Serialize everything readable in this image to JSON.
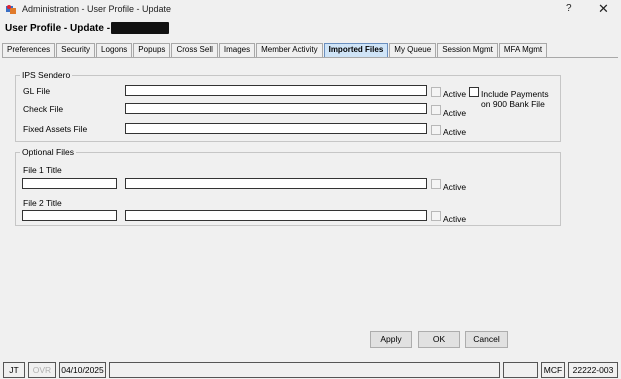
{
  "window": {
    "title": "Administration - User Profile - Update",
    "help": "?",
    "close": "✕"
  },
  "header": {
    "title": "User Profile - Update -"
  },
  "tabs": [
    {
      "label": "Preferences"
    },
    {
      "label": "Security"
    },
    {
      "label": "Logons"
    },
    {
      "label": "Popups"
    },
    {
      "label": "Cross Sell"
    },
    {
      "label": "Images"
    },
    {
      "label": "Member Activity"
    },
    {
      "label": "Imported Files",
      "active": true
    },
    {
      "label": "My Queue"
    },
    {
      "label": "Session Mgmt"
    },
    {
      "label": "MFA Mgmt"
    }
  ],
  "ips_sendero": {
    "legend": "IPS Sendero",
    "gl_file": {
      "label": "GL File",
      "value": "",
      "active_label": "Active"
    },
    "check_file": {
      "label": "Check File",
      "value": "",
      "active_label": "Active"
    },
    "fixed_assets_file": {
      "label": "Fixed Assets File",
      "value": "",
      "active_label": "Active"
    },
    "include_payments": {
      "label_line1": "Include Payments",
      "label_line2": "on 900 Bank File"
    }
  },
  "optional_files": {
    "legend": "Optional Files",
    "file1": {
      "label": "File 1 Title",
      "title_value": "",
      "path_value": "",
      "active_label": "Active"
    },
    "file2": {
      "label": "File 2 Title",
      "title_value": "",
      "path_value": "",
      "active_label": "Active"
    }
  },
  "buttons": {
    "apply": "Apply",
    "ok": "OK",
    "cancel": "Cancel"
  },
  "status_bar": {
    "user": "JT",
    "ovr": "OVR",
    "date": "04/10/2025",
    "mode": "MCF",
    "code": "22222-003"
  },
  "colors": {
    "active_tab": "#cfe4f7",
    "window_bg": "#f0f0f0"
  }
}
